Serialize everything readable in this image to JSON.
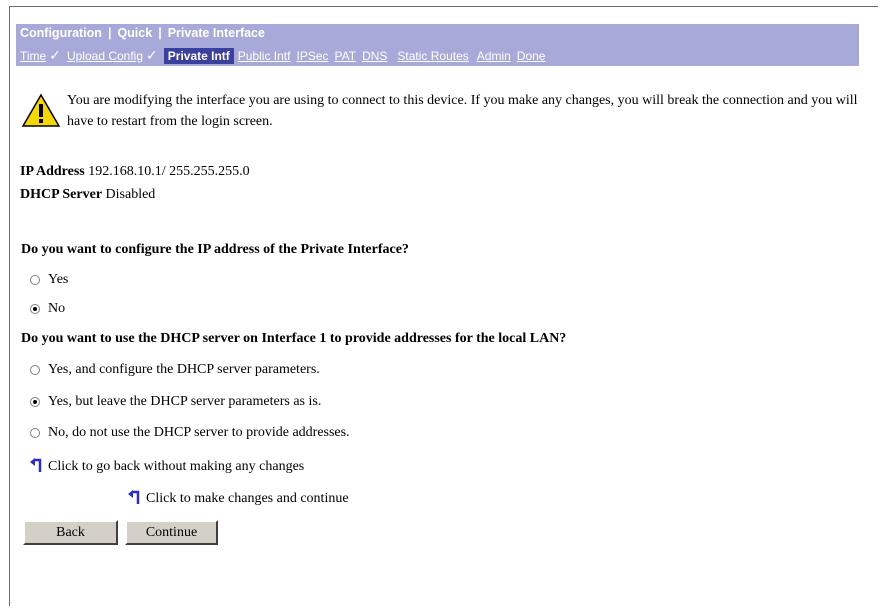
{
  "banner": {
    "crumbs": [
      "Configuration",
      "Quick",
      "Private Interface"
    ],
    "steps": [
      {
        "label": "Time",
        "done": true
      },
      {
        "label": "Upload Config",
        "done": true
      },
      {
        "label": "Private Intf",
        "current": true
      },
      {
        "label": "Public Intf"
      },
      {
        "label": "IPSec"
      },
      {
        "label": "PAT"
      },
      {
        "label": "DNS"
      },
      {
        "label": "Static Routes"
      },
      {
        "label": "Admin"
      },
      {
        "label": "Done"
      }
    ]
  },
  "warning": {
    "icon": "warning-triangle-icon",
    "text": "You are modifying the interface you are using to connect to this device. If you make any changes, you will break the connection and you will have to restart from the login screen."
  },
  "info": {
    "ip_label": "IP Address",
    "ip_value": "192.168.10.1/ 255.255.255.0",
    "dhcp_label": "DHCP Server",
    "dhcp_value": "Disabled"
  },
  "q1": {
    "question": "Do you want to configure the IP address of the Private Interface?",
    "options": [
      {
        "label": "Yes",
        "checked": false
      },
      {
        "label": "No",
        "checked": true
      }
    ]
  },
  "q2": {
    "question": "Do you want to use the DHCP server on Interface 1 to provide addresses for the local LAN?",
    "options": [
      {
        "label": "Yes, and configure the DHCP server parameters.",
        "checked": false
      },
      {
        "label": "Yes, but leave the DHCP server parameters as is.",
        "checked": true
      },
      {
        "label": "No, do not use the DHCP server to provide addresses.",
        "checked": false
      }
    ]
  },
  "links": {
    "back": "Click to go back without making any changes",
    "continue": "Click to make changes and continue"
  },
  "buttons": {
    "back": "Back",
    "continue": "Continue"
  }
}
